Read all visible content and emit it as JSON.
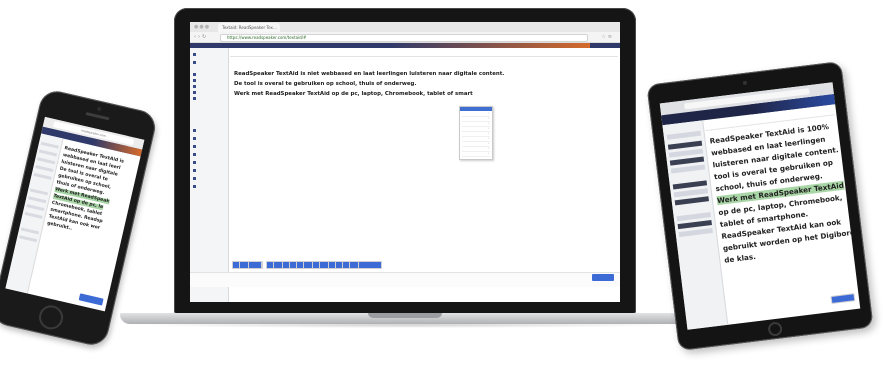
{
  "laptop": {
    "browser_tab": "Textaid: ReadSpeaker Tex...",
    "address": "https://www.readspeaker.com/textaid/#",
    "user": "",
    "app_bar_text": "",
    "editor_lines": [
      "ReadSpeaker TextAid is niet webbased en laat leerlingen luisteren naar digitale content.",
      "De tool is overal te gebruiken op school, thuis of onderweg.",
      "Werk met ReadSpeaker TextAid op de pc, laptop, Chromebook, tablet of smart"
    ]
  },
  "phone": {
    "url": "readspeaker.com",
    "text_lines": [
      "ReadSpeaker TextAid is ",
      "webbased en laat leerl",
      "luisteren naar digitale",
      "De tool is overal te",
      "gebruiken op school,",
      "thuis of onderweg.",
      "Werk met ReadSpeak",
      "TextAid op de pc, la",
      "Chromebook, tablet",
      "smartphone. Readsp",
      "TextAid kan ook wor",
      "gebruikt.."
    ]
  },
  "tablet": {
    "text_lines": [
      "ReadSpeaker TextAid is 100%",
      "webbased en laat leerlingen",
      "luisteren naar digitale content. De",
      "tool is overal te gebruiken op",
      "school, thuis of onderweg.",
      "Werk met ReadSpeaker TextAid",
      "op de pc, laptop, Chromebook,",
      "tablet of smartphone.",
      "ReadSpeaker TextAid kan ook",
      "gebruikt worden op het Digibord in",
      "de klas."
    ]
  }
}
